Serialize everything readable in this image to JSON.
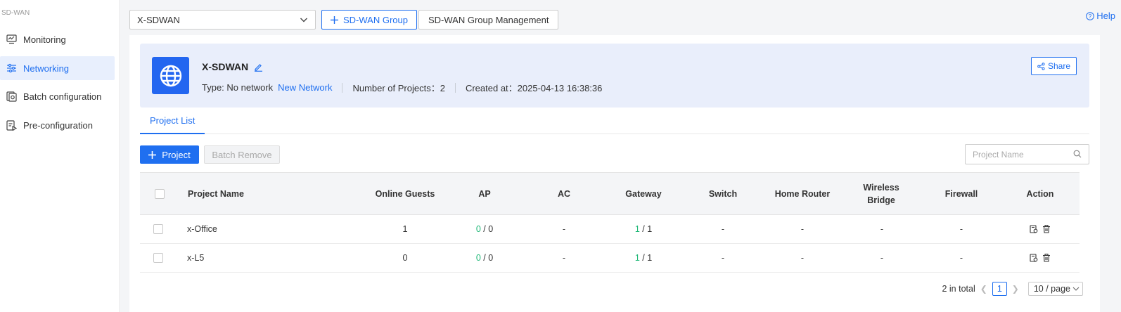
{
  "sidebar": {
    "brand": "SD-WAN",
    "items": [
      {
        "label": "Monitoring",
        "icon": "chart-monitor-icon",
        "active": false
      },
      {
        "label": "Networking",
        "icon": "sliders-icon",
        "active": true
      },
      {
        "label": "Batch configuration",
        "icon": "batch-config-icon",
        "active": false
      },
      {
        "label": "Pre-configuration",
        "icon": "pre-config-icon",
        "active": false
      }
    ]
  },
  "topbar": {
    "group_select_value": "X-SDWAN",
    "add_group_label": "SD-WAN Group",
    "group_management_label": "SD-WAN Group Management",
    "help_label": "Help"
  },
  "banner": {
    "name": "X-SDWAN",
    "type_label": "Type: No network",
    "new_network_label": "New Network",
    "projects_label": "Number of Projects：2",
    "created_label": "Created at：2025-04-13 16:38:36",
    "share_label": "Share"
  },
  "tabs": [
    {
      "label": "Project List",
      "active": true
    }
  ],
  "toolbar": {
    "add_project_label": "Project",
    "batch_remove_label": "Batch Remove",
    "search_placeholder": "Project Name"
  },
  "table": {
    "columns": [
      "Project Name",
      "Online Guests",
      "AP",
      "AC",
      "Gateway",
      "Switch",
      "Home Router",
      "Wireless Bridge",
      "Firewall",
      "Action"
    ],
    "rows": [
      {
        "name": "x-Office",
        "online_guests": "1",
        "ap_online": "0",
        "ap_total": " / 0",
        "ac": "-",
        "gw_online": "1",
        "gw_total": " / 1",
        "switch": "-",
        "home_router": "-",
        "wireless_bridge": "-",
        "firewall": "-"
      },
      {
        "name": "x-L5",
        "online_guests": "0",
        "ap_online": "0",
        "ap_total": " / 0",
        "ac": "-",
        "gw_online": "1",
        "gw_total": " / 1",
        "switch": "-",
        "home_router": "-",
        "wireless_bridge": "-",
        "firewall": "-"
      }
    ]
  },
  "pagination": {
    "total_label": "2 in total",
    "current_page": "1",
    "page_size_label": "10 / page"
  },
  "colors": {
    "primary": "#1f6ff0",
    "online_green": "#1fb877",
    "banner_bg": "#e9eefb"
  }
}
